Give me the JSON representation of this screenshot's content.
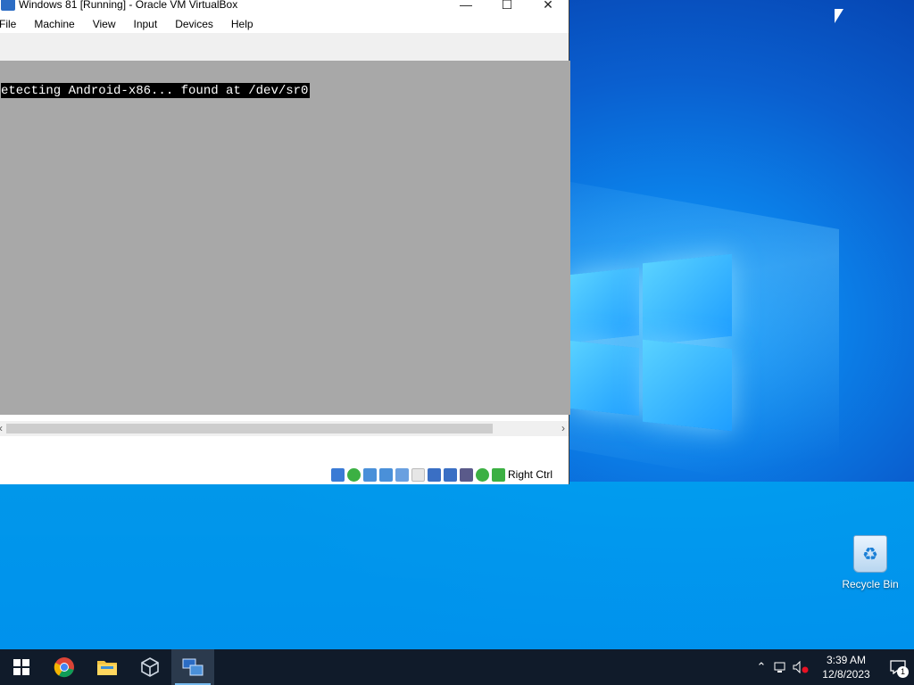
{
  "window": {
    "title": "Windows 81 [Running] - Oracle VM VirtualBox",
    "controls": {
      "minimize": "—",
      "maximize": "☐",
      "close": "✕"
    }
  },
  "menu": {
    "items": [
      {
        "label": "File"
      },
      {
        "label": "Machine"
      },
      {
        "label": "View"
      },
      {
        "label": "Input"
      },
      {
        "label": "Devices"
      },
      {
        "label": "Help"
      }
    ]
  },
  "vm_screen": {
    "console_text": "etecting Android-x86... found at /dev/sr0"
  },
  "statusbar": {
    "host_key": "Right Ctrl",
    "icons": [
      {
        "name": "hard-disk-icon",
        "color": "#3a7bd5"
      },
      {
        "name": "optical-drive-icon",
        "color": "#3cb043"
      },
      {
        "name": "audio-icon",
        "color": "#4a90d9"
      },
      {
        "name": "network-icon",
        "color": "#4a90d9"
      },
      {
        "name": "usb-icon",
        "color": "#6aa0e0"
      },
      {
        "name": "shared-folders-icon",
        "color": "#dddddd"
      },
      {
        "name": "display-icon",
        "color": "#3a6fc4"
      },
      {
        "name": "recording-icon",
        "color": "#3a6fc4"
      },
      {
        "name": "cpu-icon",
        "color": "#5a5a8a"
      },
      {
        "name": "mouse-integration-icon",
        "color": "#3cb043"
      },
      {
        "name": "keyboard-icon",
        "color": "#3cb043"
      }
    ]
  },
  "desktop": {
    "recycle_bin_label": "Recycle Bin"
  },
  "taskbar": {
    "apps": [
      {
        "name": "chrome"
      },
      {
        "name": "file-explorer"
      },
      {
        "name": "virtualbox"
      },
      {
        "name": "virtualbox-vm"
      }
    ],
    "clock_time": "3:39 AM",
    "clock_date": "12/8/2023",
    "notification_count": "1"
  },
  "colors": {
    "taskbar_bg": "#101b2a",
    "desktop_blue": "#0b7fe8",
    "vm_screen_bg": "#a8a8a8"
  }
}
